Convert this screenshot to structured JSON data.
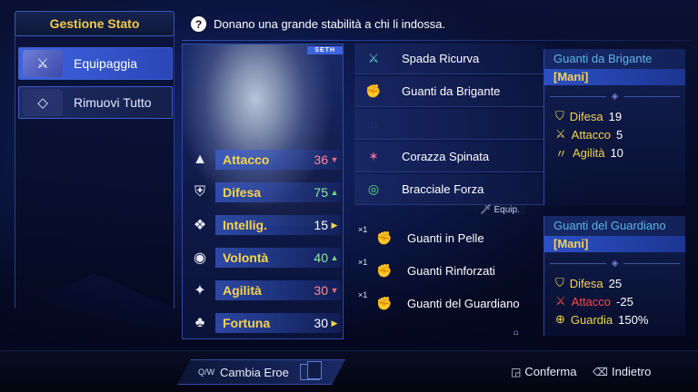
{
  "menu": {
    "title": "Gestione Stato",
    "equip_label": "Equipaggia",
    "remove_all_label": "Rimuovi Tutto"
  },
  "hint": {
    "icon": "?",
    "text": "Donano una grande stabilità a chi li indossa."
  },
  "character": {
    "name_tag": "SETH",
    "stats": [
      {
        "name": "Attacco",
        "value": "36",
        "arrow": "▼",
        "arrow_color": "#ff6b7a",
        "value_color": "#ff8a95",
        "icon": "▲"
      },
      {
        "name": "Difesa",
        "value": "75",
        "arrow": "▲",
        "arrow_color": "#6be57a",
        "value_color": "#8af09a",
        "icon": "⛨"
      },
      {
        "name": "Intellig.",
        "value": "15",
        "arrow": "▶",
        "arrow_color": "#f6d34e",
        "value_color": "#ffffff",
        "icon": "❖"
      },
      {
        "name": "Volontà",
        "value": "40",
        "arrow": "▲",
        "arrow_color": "#6be57a",
        "value_color": "#8af09a",
        "icon": "◉"
      },
      {
        "name": "Agilità",
        "value": "30",
        "arrow": "▼",
        "arrow_color": "#ff6b7a",
        "value_color": "#ff8a95",
        "icon": "✦"
      },
      {
        "name": "Fortuna",
        "value": "30",
        "arrow": "▶",
        "arrow_color": "#f6d34e",
        "value_color": "#ffffff",
        "icon": "♣"
      }
    ]
  },
  "equipped": [
    {
      "name": "Spada Ricurva",
      "icon": "⚔",
      "icon_color": "#5ad3c0"
    },
    {
      "name": "Guanti da Brigante",
      "icon": "✊",
      "icon_color": "#e04a4a"
    },
    {
      "name": "",
      "icon": "◌",
      "icon_color": "#3a4fa0"
    },
    {
      "name": "Corazza Spinata",
      "icon": "✶",
      "icon_color": "#f06a9a"
    },
    {
      "name": "Bracciale Forza",
      "icon": "◎",
      "icon_color": "#5fe08a"
    }
  ],
  "equip_tag": "Equip.",
  "current_item": {
    "name": "Guanti da Brigante",
    "slot": "[Mani]",
    "stats": [
      {
        "icon": "⛉",
        "label": "Difesa",
        "value": "19",
        "negative": false
      },
      {
        "icon": "⚔",
        "label": "Attacco",
        "value": "5",
        "negative": false
      },
      {
        "icon": "〃",
        "label": "Agilità",
        "value": "10",
        "negative": false
      }
    ]
  },
  "inventory": [
    {
      "qty": "×1",
      "name": "Guanti in Pelle",
      "icon": "✊",
      "icon_color": "#d8552a"
    },
    {
      "qty": "×1",
      "name": "Guanti Rinforzati",
      "icon": "✊",
      "icon_color": "#e0a030"
    },
    {
      "qty": "×1",
      "name": "Guanti del Guardiano",
      "icon": "✊",
      "icon_color": "#5a6ae8"
    }
  ],
  "compare_item": {
    "name": "Guanti del Guardiano",
    "slot": "[Mani]",
    "stats": [
      {
        "icon": "⛉",
        "label": "Difesa",
        "value": "25",
        "negative": false
      },
      {
        "icon": "⚔",
        "label": "Attacco",
        "value": "-25",
        "negative": true
      },
      {
        "icon": "⊕",
        "label": "Guardia",
        "value": "150%",
        "negative": false
      }
    ]
  },
  "scroll_indicator": "⩍",
  "footer": {
    "hero_keys": "Q/W",
    "hero_label": "Cambia Eroe",
    "confirm_icon": "◲",
    "confirm_label": "Conferma",
    "back_icon": "⌫",
    "back_label": "Indietro"
  }
}
